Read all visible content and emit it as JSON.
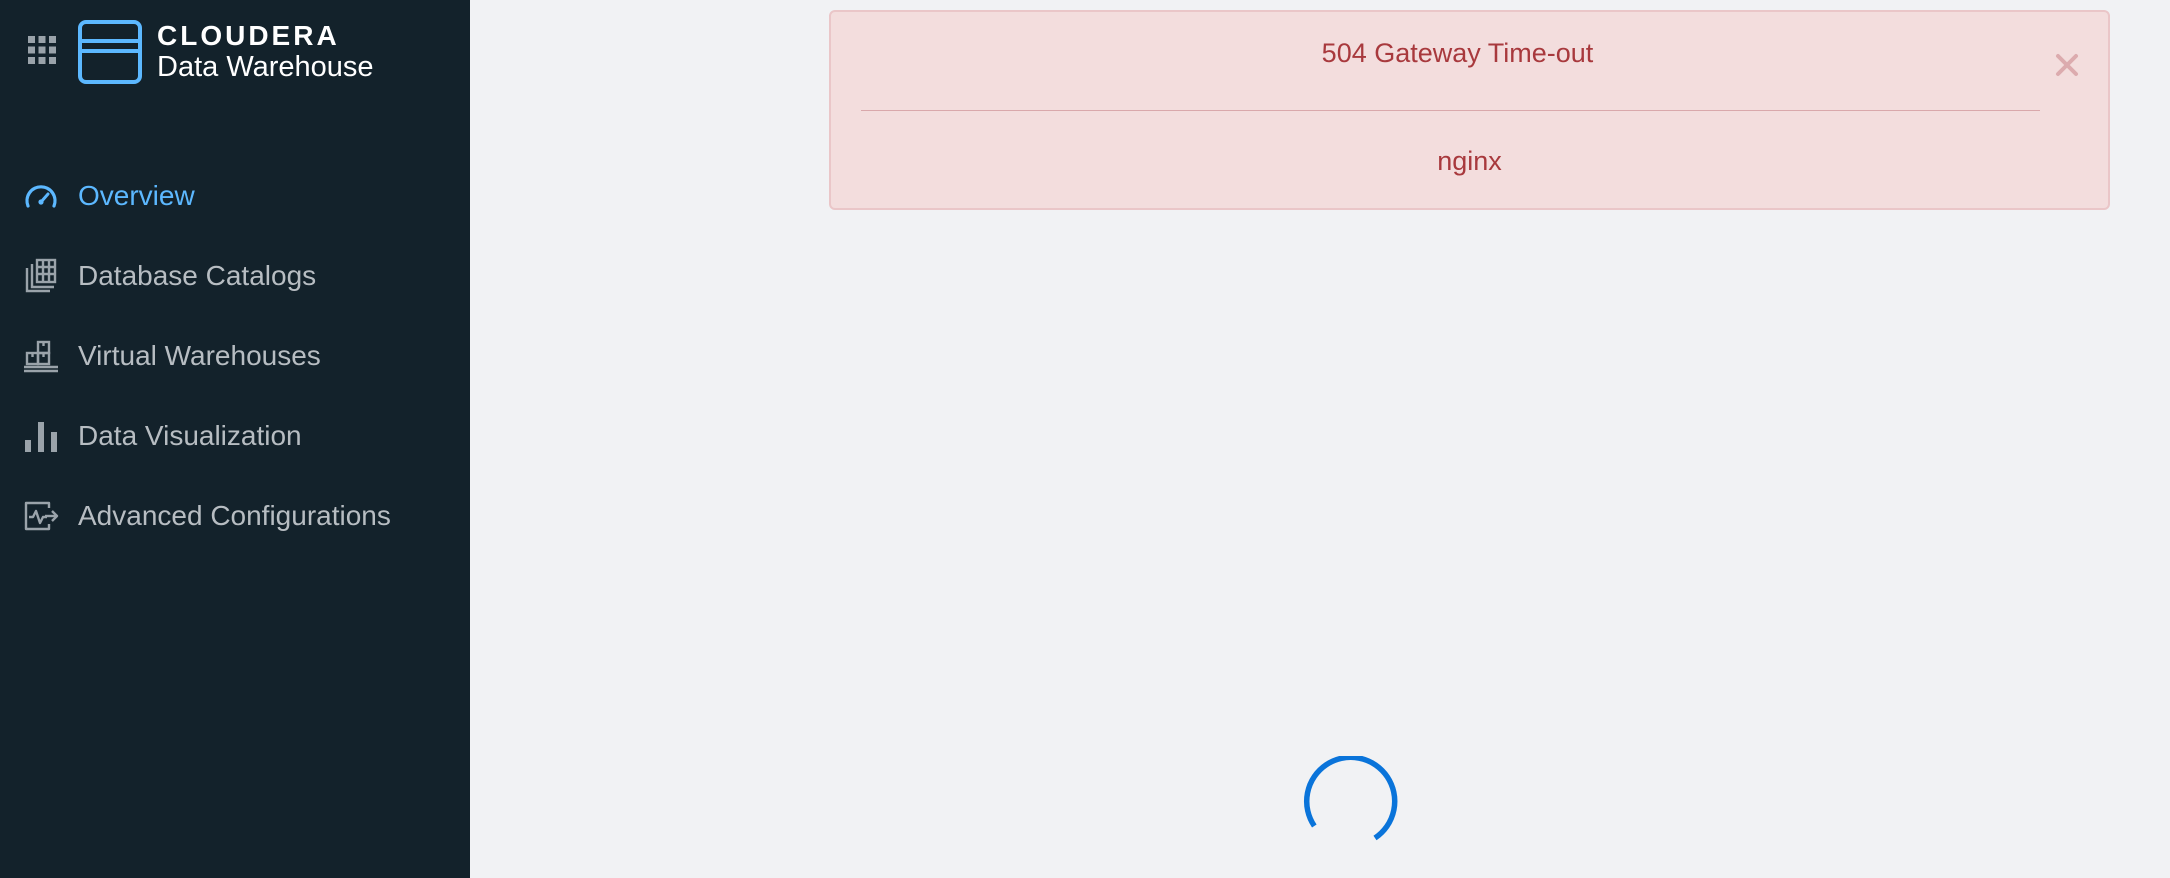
{
  "brand": {
    "company": "CLOUDERA",
    "product": "Data Warehouse"
  },
  "sidebar": {
    "items": [
      {
        "label": "Overview",
        "icon": "speedometer-icon",
        "active": true
      },
      {
        "label": "Database Catalogs",
        "icon": "database-catalog-icon",
        "active": false
      },
      {
        "label": "Virtual Warehouses",
        "icon": "virtual-warehouse-icon",
        "active": false
      },
      {
        "label": "Data Visualization",
        "icon": "bar-chart-icon",
        "active": false
      },
      {
        "label": "Advanced Configurations",
        "icon": "advanced-config-icon",
        "active": false
      }
    ]
  },
  "alert": {
    "title": "504 Gateway Time-out",
    "body": "nginx",
    "close_glyph": "×"
  },
  "colors": {
    "sidebar_bg": "#13222b",
    "active_accent": "#5cb8ff",
    "nav_text": "#b7bdc2",
    "alert_bg": "#f3dddd",
    "alert_text": "#a8393d",
    "spinner": "#0a74da"
  }
}
